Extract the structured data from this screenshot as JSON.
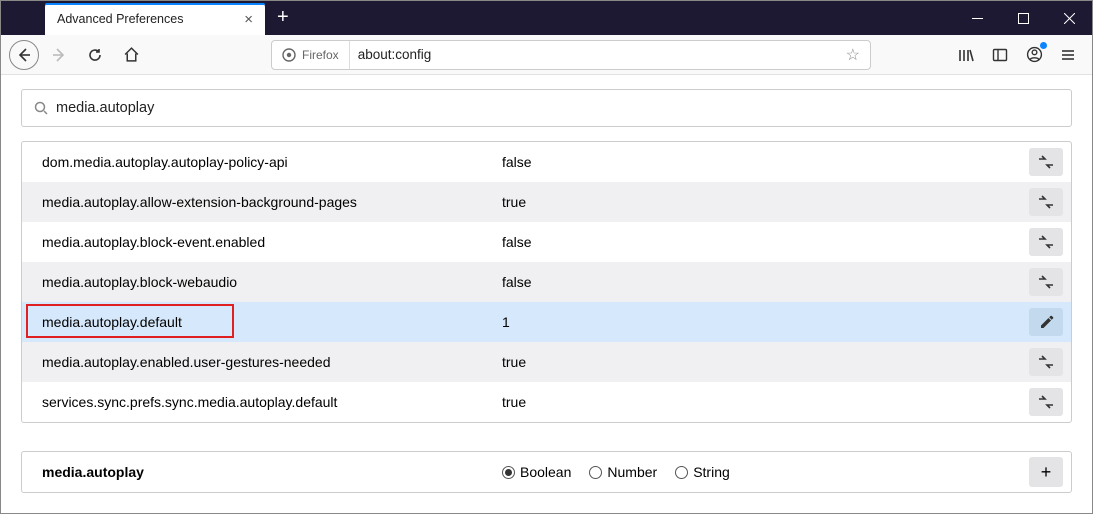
{
  "tab": {
    "title": "Advanced Preferences"
  },
  "urlbar": {
    "identity": "Firefox",
    "url": "about:config"
  },
  "search": {
    "value": "media.autoplay"
  },
  "prefs": [
    {
      "name": "dom.media.autoplay.autoplay-policy-api",
      "value": "false",
      "action": "toggle",
      "highlight": false,
      "boxed": false
    },
    {
      "name": "media.autoplay.allow-extension-background-pages",
      "value": "true",
      "action": "toggle",
      "highlight": false,
      "boxed": false
    },
    {
      "name": "media.autoplay.block-event.enabled",
      "value": "false",
      "action": "toggle",
      "highlight": false,
      "boxed": false
    },
    {
      "name": "media.autoplay.block-webaudio",
      "value": "false",
      "action": "toggle",
      "highlight": false,
      "boxed": false
    },
    {
      "name": "media.autoplay.default",
      "value": "1",
      "action": "edit",
      "highlight": true,
      "boxed": true
    },
    {
      "name": "media.autoplay.enabled.user-gestures-needed",
      "value": "true",
      "action": "toggle",
      "highlight": false,
      "boxed": false
    },
    {
      "name": "services.sync.prefs.sync.media.autoplay.default",
      "value": "true",
      "action": "toggle",
      "highlight": false,
      "boxed": false
    }
  ],
  "addrow": {
    "name": "media.autoplay",
    "options": [
      {
        "label": "Boolean",
        "checked": true
      },
      {
        "label": "Number",
        "checked": false
      },
      {
        "label": "String",
        "checked": false
      }
    ]
  }
}
